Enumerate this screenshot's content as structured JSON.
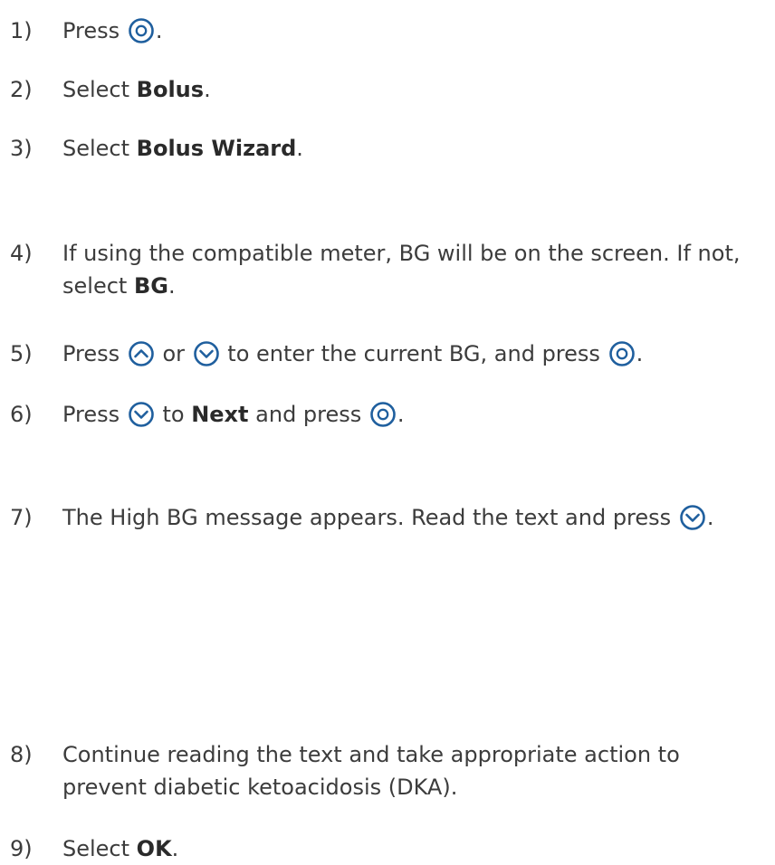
{
  "colors": {
    "text": "#3c3c3c",
    "icon": "#1f5f9e"
  },
  "steps": [
    {
      "number": "1)",
      "parts": {
        "a": "Press",
        "b": "."
      },
      "icons": [
        "select-button-icon"
      ]
    },
    {
      "number": "2)",
      "parts": {
        "a": "Select ",
        "b": "Bolus",
        "c": "."
      }
    },
    {
      "number": "3)",
      "parts": {
        "a": "Select ",
        "b": "Bolus Wizard",
        "c": "."
      }
    },
    {
      "number": "4)",
      "parts": {
        "a": "If using the compatible meter, BG will be on the screen. If not,",
        "b": "select ",
        "c": "BG",
        "d": "."
      }
    },
    {
      "number": "5)",
      "parts": {
        "a": "Press",
        "b": "or",
        "c": "to enter the current BG, and press",
        "d": "."
      },
      "icons": [
        "up-button-icon",
        "down-button-icon",
        "select-button-icon"
      ]
    },
    {
      "number": "6)",
      "parts": {
        "a": "Press",
        "b": "to ",
        "c": "Next",
        "d": " and press",
        "e": "."
      },
      "icons": [
        "down-button-icon",
        "select-button-icon"
      ]
    },
    {
      "number": "7)",
      "parts": {
        "a": "The High BG message appears. Read the text and press",
        "b": "."
      },
      "icons": [
        "down-button-icon"
      ]
    },
    {
      "number": "8)",
      "parts": {
        "a": "Continue reading the text and take appropriate action to",
        "b": "prevent diabetic ketoacidosis (DKA)."
      }
    },
    {
      "number": "9)",
      "parts": {
        "a": "Select ",
        "b": "OK",
        "c": "."
      }
    }
  ]
}
